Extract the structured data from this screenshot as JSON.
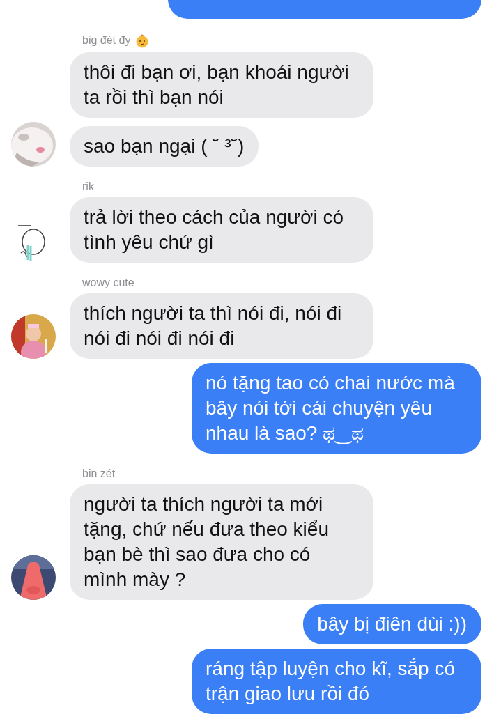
{
  "messages": [
    {
      "kind": "outgoing_cut"
    },
    {
      "kind": "incoming",
      "sender": "big đét đy",
      "sender_badge": true,
      "text": "thôi đi bạn ơi, bạn khoái người ta rồi thì bạn nói",
      "avatar": false
    },
    {
      "kind": "incoming",
      "text": "sao bạn ngại ( ˘ ³˘)",
      "avatar": true
    },
    {
      "kind": "incoming",
      "sender": "rik",
      "sender_badge": false,
      "text": "trả lời theo cách của người có tình yêu chứ gì",
      "avatar": true
    },
    {
      "kind": "incoming",
      "sender": "wowy cute",
      "sender_badge": false,
      "text": "thích người ta thì nói đi, nói đi nói đi nói đi nói đi",
      "avatar": true
    },
    {
      "kind": "outgoing",
      "text": "nó tặng tao có chai nước mà bây nói tới cái chuyện yêu nhau là sao? ಥ‿ಥ"
    },
    {
      "kind": "incoming",
      "sender": "bin zét",
      "sender_badge": false,
      "text": "người ta thích người ta mới tặng, chứ nếu đưa theo kiểu bạn bè thì sao đưa cho có mình mày ?",
      "avatar": true
    },
    {
      "kind": "outgoing",
      "text": "bây bị điên dùi :))"
    },
    {
      "kind": "outgoing",
      "text": "ráng tập luyện cho kĩ, sắp có trận giao lưu rồi đó"
    }
  ]
}
